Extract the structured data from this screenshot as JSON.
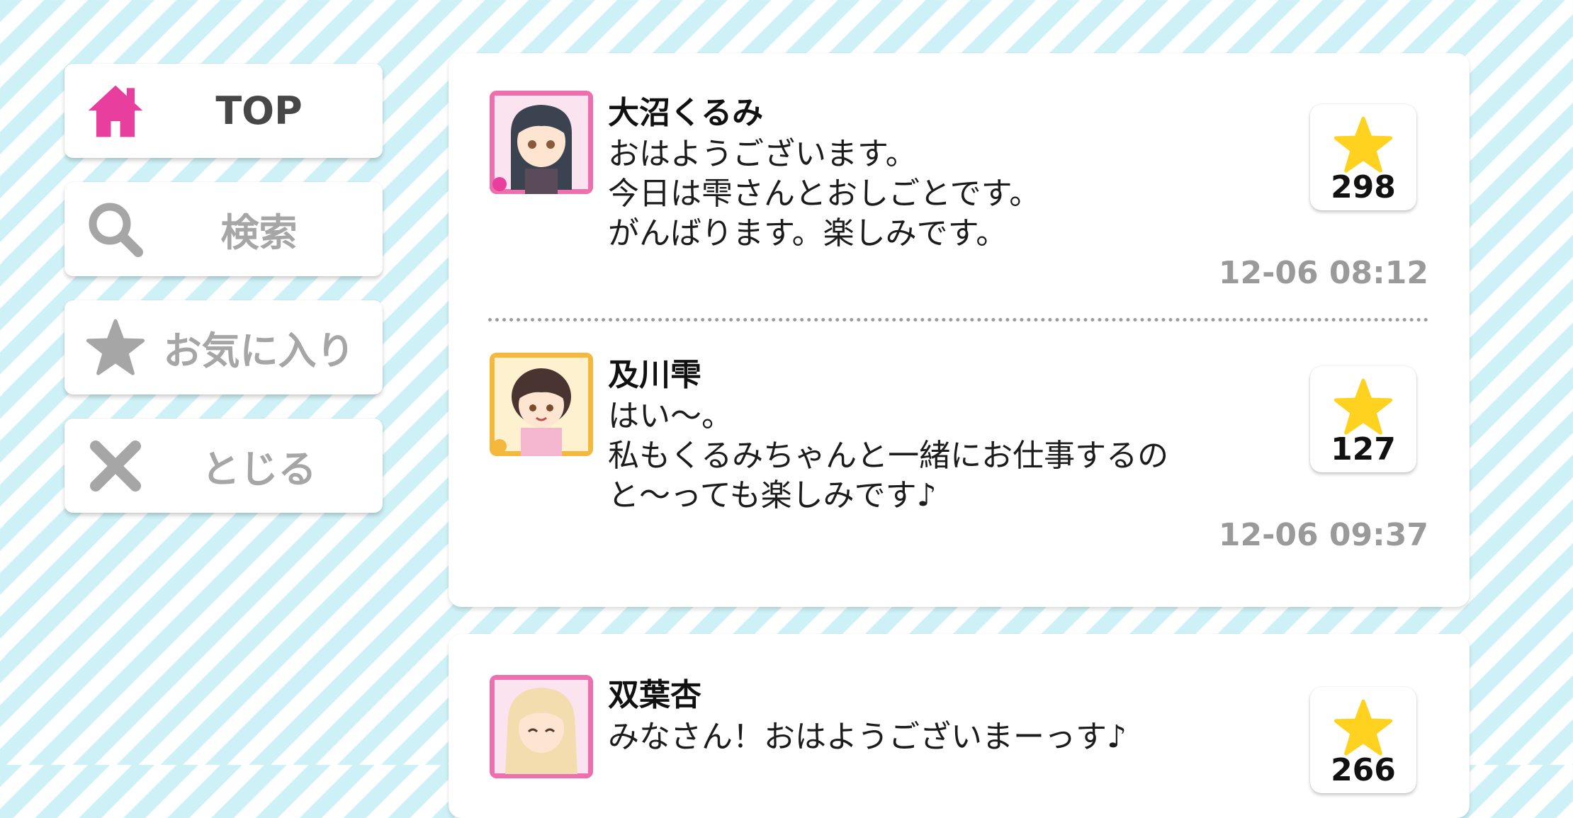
{
  "nav": {
    "top_label": "TOP",
    "search_label": "検索",
    "favorites_label": "お気に入り",
    "close_label": "とじる"
  },
  "colors": {
    "accent": "#e83e9e",
    "star": "#ffd21f",
    "muted": "#a6a6a6"
  },
  "posts": [
    {
      "name": "大沼くるみ",
      "lines": [
        "おはようございます。",
        "今日は雫さんとおしごとです。",
        "がんばります。楽しみです。"
      ],
      "likes": "298",
      "time": "12-06 08:12"
    },
    {
      "name": "及川雫",
      "lines": [
        "はい～。",
        "私もくるみちゃんと一緒にお仕事するの",
        "と～っても楽しみです♪"
      ],
      "likes": "127",
      "time": "12-06 09:37"
    },
    {
      "name": "双葉杏",
      "lines": [
        "みなさん！おはようございまーっす♪"
      ],
      "likes": "266"
    }
  ]
}
